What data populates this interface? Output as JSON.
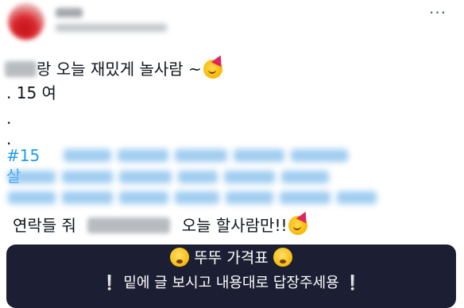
{
  "tweet": {
    "more_label": "···",
    "line1_text": "랑 오늘 재밌게 놀사람 ~",
    "line2_text": ". 15 여",
    "dot1": ".",
    "dot2": ".",
    "hashtag_visible": "#15살",
    "contact_prefix": "연락들 줘",
    "contact_suffix": "오늘 할사람만!!",
    "banner_title": "뚜뚜 가격표",
    "banner_sub": "밑에 글 보시고 내용대로 답장주세용",
    "banner_exclaim": "❕"
  },
  "icons": {
    "party": "partying-face-icon",
    "dizzy": "dizzy-face-icon"
  },
  "colors": {
    "hashtag": "#1d9bf0",
    "banner_bg": "#1c1f33",
    "text": "#0f1419"
  }
}
